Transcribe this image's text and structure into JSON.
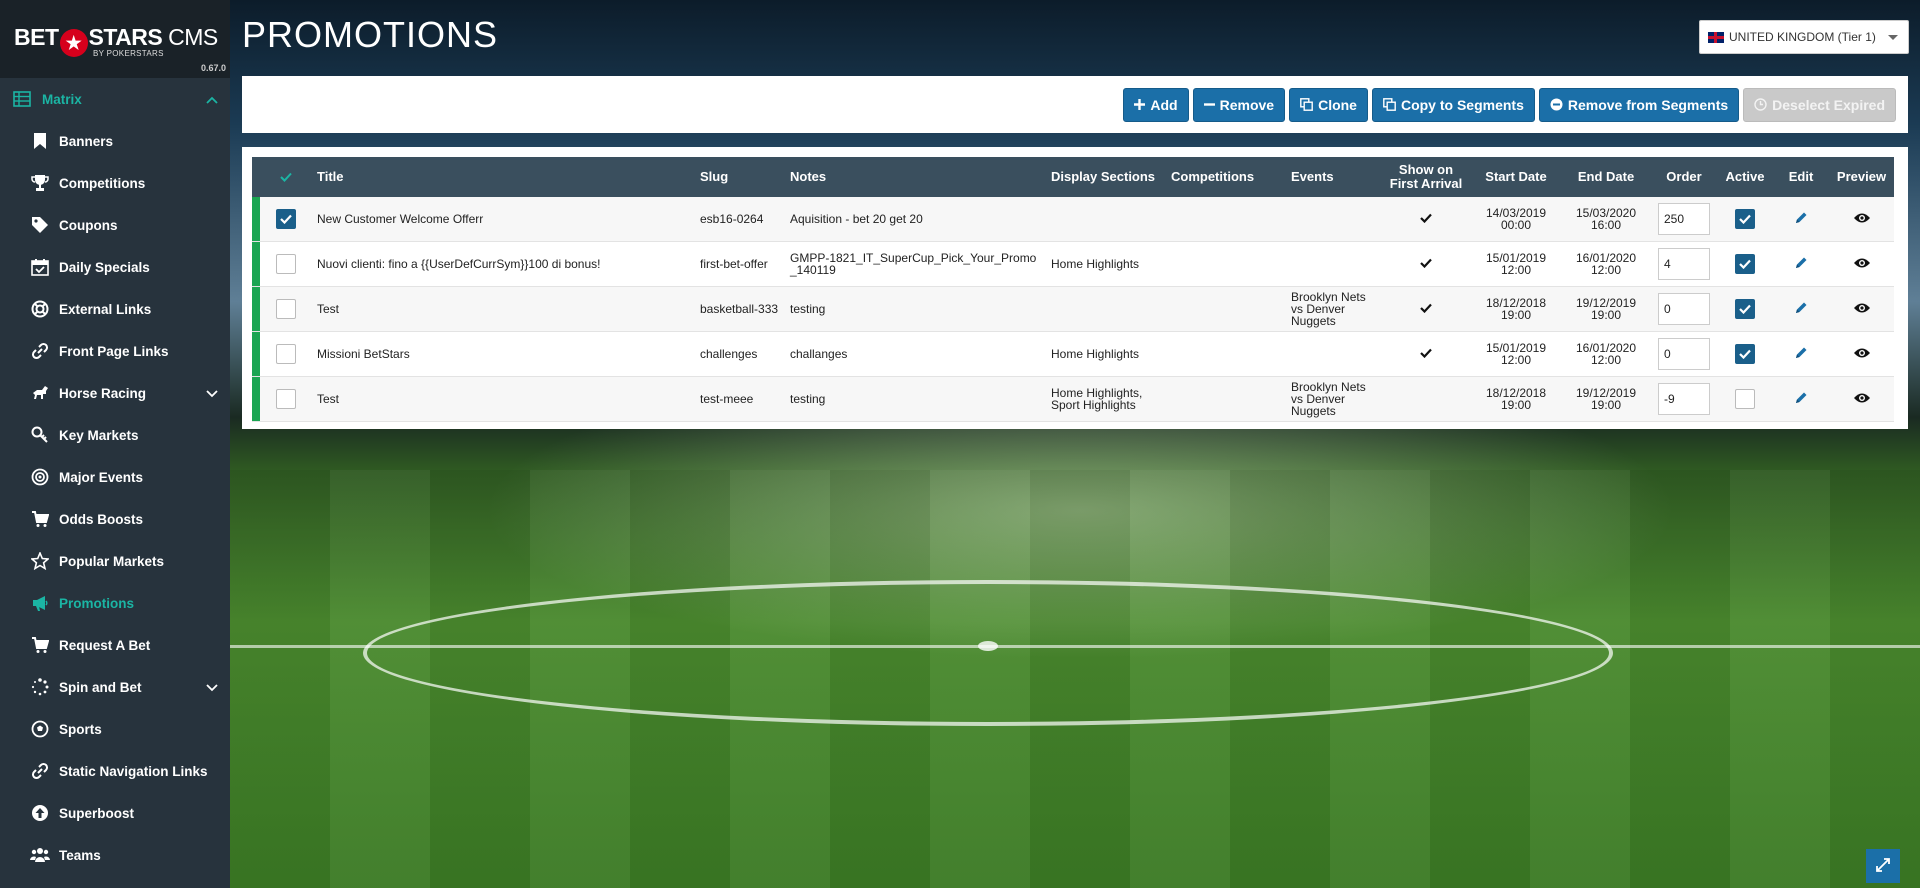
{
  "brand": {
    "name_left": "BET",
    "name_right": "STARS",
    "cms": "CMS",
    "sub": "BY POKERSTARS",
    "version": "0.67.0"
  },
  "sidebar": {
    "matrix_label": "Matrix",
    "items": [
      {
        "label": "Banners",
        "icon": "bookmark-icon"
      },
      {
        "label": "Competitions",
        "icon": "trophy-icon"
      },
      {
        "label": "Coupons",
        "icon": "tag-icon"
      },
      {
        "label": "Daily Specials",
        "icon": "calendar-check-icon"
      },
      {
        "label": "External Links",
        "icon": "life-ring-icon"
      },
      {
        "label": "Front Page Links",
        "icon": "link-icon"
      },
      {
        "label": "Horse Racing",
        "icon": "horse-icon"
      },
      {
        "label": "Key Markets",
        "icon": "key-icon"
      },
      {
        "label": "Major Events",
        "icon": "bullseye-icon"
      },
      {
        "label": "Odds Boosts",
        "icon": "cart-icon"
      },
      {
        "label": "Popular Markets",
        "icon": "star-icon"
      },
      {
        "label": "Promotions",
        "icon": "bullhorn-icon"
      },
      {
        "label": "Request A Bet",
        "icon": "cart-icon"
      },
      {
        "label": "Spin and Bet",
        "icon": "spinner-icon"
      },
      {
        "label": "Sports",
        "icon": "soccer-ball-icon"
      },
      {
        "label": "Static Navigation Links",
        "icon": "link-icon"
      },
      {
        "label": "Superboost",
        "icon": "arrow-circle-up-icon"
      },
      {
        "label": "Teams",
        "icon": "users-icon"
      }
    ]
  },
  "header": {
    "title": "PROMOTIONS",
    "region": "UNITED KINGDOM (Tier 1)"
  },
  "toolbar": {
    "add": "Add",
    "remove": "Remove",
    "clone": "Clone",
    "copy_segments": "Copy to Segments",
    "remove_segments": "Remove from Segments",
    "deselect_expired": "Deselect Expired"
  },
  "table": {
    "columns": {
      "title": "Title",
      "slug": "Slug",
      "notes": "Notes",
      "display_sections": "Display Sections",
      "competitions": "Competitions",
      "events": "Events",
      "show_first_line1": "Show on",
      "show_first_line2": "First Arrival",
      "start_date": "Start Date",
      "end_date": "End Date",
      "order": "Order",
      "active": "Active",
      "edit": "Edit",
      "preview": "Preview"
    },
    "rows": [
      {
        "selected": true,
        "title": "New Customer Welcome Offerr",
        "slug": "esb16-0264",
        "notes": "Aquisition - bet 20 get 20",
        "display_sections": "",
        "competitions": "",
        "events": "",
        "first_arrival": true,
        "start_date": "14/03/2019",
        "start_time": "00:00",
        "end_date": "15/03/2020",
        "end_time": "16:00",
        "order": "250",
        "active": true
      },
      {
        "selected": false,
        "title": "Nuovi clienti: fino a {{UserDefCurrSym}}100 di bonus!",
        "slug": "first-bet-offer",
        "notes": "GMPP-1821_IT_SuperCup_Pick_Your_Promo_140119",
        "display_sections": "Home Highlights",
        "competitions": "",
        "events": "",
        "first_arrival": true,
        "start_date": "15/01/2019",
        "start_time": "12:00",
        "end_date": "16/01/2020",
        "end_time": "12:00",
        "order": "4",
        "active": true
      },
      {
        "selected": false,
        "title": "Test",
        "slug": "basketball-333",
        "notes": "testing",
        "display_sections": "",
        "competitions": "",
        "events": "Brooklyn Nets vs Denver Nuggets",
        "first_arrival": true,
        "start_date": "18/12/2018",
        "start_time": "19:00",
        "end_date": "19/12/2019",
        "end_time": "19:00",
        "order": "0",
        "active": true
      },
      {
        "selected": false,
        "title": "Missioni BetStars",
        "slug": "challenges",
        "notes": "challanges",
        "display_sections": "Home Highlights",
        "competitions": "",
        "events": "",
        "first_arrival": true,
        "start_date": "15/01/2019",
        "start_time": "12:00",
        "end_date": "16/01/2020",
        "end_time": "12:00",
        "order": "0",
        "active": true
      },
      {
        "selected": false,
        "title": "Test",
        "slug": "test-meee",
        "notes": "testing",
        "display_sections": "Home Highlights, Sport Highlights",
        "competitions": "",
        "events": "Brooklyn Nets vs Denver Nuggets",
        "first_arrival": false,
        "start_date": "18/12/2018",
        "start_time": "19:00",
        "end_date": "19/12/2019",
        "end_time": "19:00",
        "order": "-9",
        "active": false
      }
    ]
  },
  "colors": {
    "accent": "#1bb5a4",
    "primary": "#1b6fa8",
    "sidebar": "#27333d",
    "header_row": "#3a4f5e",
    "status": "#1aa552"
  }
}
